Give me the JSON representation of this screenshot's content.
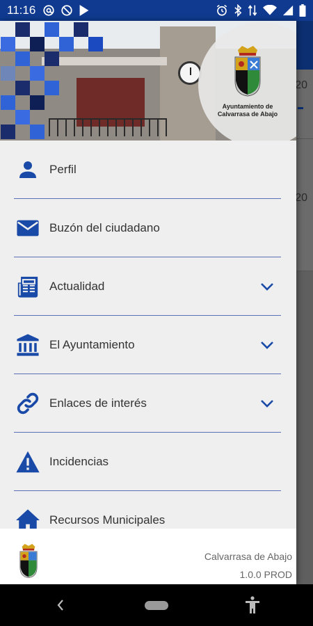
{
  "status_bar": {
    "time": "11:16",
    "left_icons": [
      "at-icon",
      "no-disturb-icon",
      "play-store-icon"
    ],
    "right_icons": [
      "alarm-icon",
      "bluetooth-icon",
      "data-arrows-icon",
      "wifi-icon",
      "signal-icon",
      "battery-icon"
    ]
  },
  "header": {
    "logo_text_line1": "Ayuntamiento de",
    "logo_text_line2": "Calvarrasa de Abajo"
  },
  "background_app": {
    "card_1_text": "20",
    "card_2_text": "20"
  },
  "menu": {
    "items": [
      {
        "label": "Perfil",
        "icon": "person-icon",
        "expandable": false
      },
      {
        "label": "Buzón del ciudadano",
        "icon": "mail-icon",
        "expandable": false
      },
      {
        "label": "Actualidad",
        "icon": "newspaper-icon",
        "expandable": true
      },
      {
        "label": "El Ayuntamiento",
        "icon": "bank-icon",
        "expandable": true
      },
      {
        "label": "Enlaces de interés",
        "icon": "link-icon",
        "expandable": true
      },
      {
        "label": "Incidencias",
        "icon": "warning-icon",
        "expandable": false
      },
      {
        "label": "Recursos Municipales",
        "icon": "home-icon",
        "expandable": false
      }
    ]
  },
  "footer": {
    "town": "Calvarrasa de Abajo",
    "version": "1.0.0 PROD"
  },
  "colors": {
    "accent": "#1a4aa8",
    "status_bar": "#0f3a8f",
    "drawer_bg": "#efefef",
    "divider": "#5a6fb5"
  }
}
